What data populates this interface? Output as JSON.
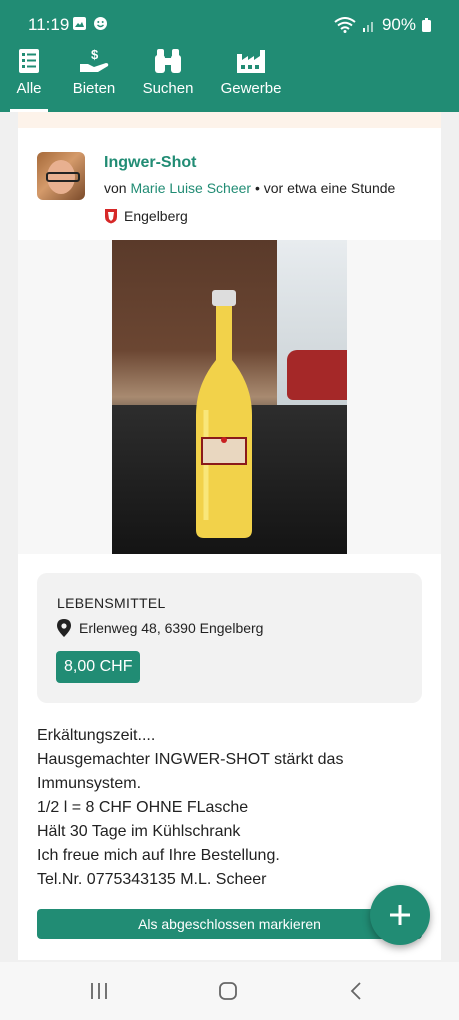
{
  "status_bar": {
    "time": "11:19",
    "battery": "90%"
  },
  "tabs": [
    {
      "label": "Alle",
      "icon": "list-icon",
      "active": true
    },
    {
      "label": "Bieten",
      "icon": "hand-money-icon"
    },
    {
      "label": "Suchen",
      "icon": "binoculars-icon"
    },
    {
      "label": "Gewerbe",
      "icon": "factory-icon"
    }
  ],
  "post": {
    "title": "Ingwer-Shot",
    "by": "von",
    "author": "Marie Luise Scheer",
    "time": " • vor etwa eine Stunde",
    "location": "Engelberg",
    "category": "LEBENSMITTEL",
    "address": "Erlenweg 48, 6390 Engelberg",
    "price": "8,00 CHF",
    "description": [
      "Erkältungszeit....",
      "Hausgemachter INGWER-SHOT stärkt das",
      "Immunsystem.",
      "1/2 l = 8 CHF OHNE FLasche",
      "Hält 30 Tage im Kühlschrank",
      "Ich freue mich auf Ihre Bestellung.",
      "Tel.Nr. 0775343135 M.L. Scheer"
    ],
    "done_button": "Als abgeschlossen markieren"
  },
  "colors": {
    "brand": "#218c74",
    "info_bg": "#f2f2f2"
  }
}
